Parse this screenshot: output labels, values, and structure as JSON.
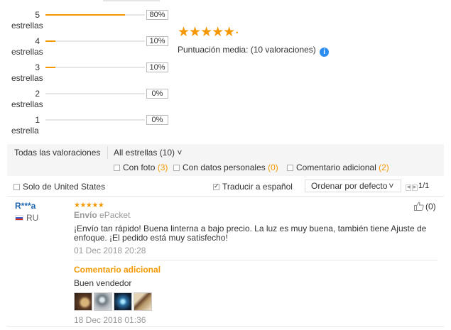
{
  "distribution": [
    {
      "num": "5",
      "word": "estrellas",
      "pct_label": "80%",
      "fill": 0.8
    },
    {
      "num": "4",
      "word": "estrellas",
      "pct_label": "10%",
      "fill": 0.1
    },
    {
      "num": "3",
      "word": "estrellas",
      "pct_label": "10%",
      "fill": 0.1
    },
    {
      "num": "2",
      "word": "estrellas",
      "pct_label": "0%",
      "fill": 0.0
    },
    {
      "num": "1",
      "word": "estrella",
      "pct_label": "0%",
      "fill": 0.0
    }
  ],
  "average": {
    "stars": "★★★★★",
    "label": "Puntuación media:",
    "count": "(10 valoraciones)",
    "info_icon": "info-icon"
  },
  "filters": {
    "all_label": "Todas las valoraciones",
    "select_value": "All estrellas (10)",
    "chevron": "˅",
    "photo_label": "Con foto",
    "photo_count": "(3)",
    "personal_label": "Con datos personales",
    "personal_count": "(0)",
    "additional_label": "Comentario adicional",
    "additional_count": "(2)"
  },
  "options": {
    "us_only": "Solo de United States",
    "translate": "Traducir a español",
    "sort_value": "Ordenar por defecto",
    "sort_chevron": "˅",
    "pager": "1/1"
  },
  "review": {
    "user": "R***a",
    "country": "RU",
    "stars": "★★★★★",
    "ship_label": "Envío",
    "ship_method": "ePacket",
    "text": "¡Envío tan rápido! Buena linterna a bajo precio. La luz es muy buena, también tiene Ajuste de enfoque. ¡El pedido está muy satisfecho!",
    "date": "01 Dec 2018 20:28",
    "additional_label": "Comentario adicional",
    "additional_text": "Buen vendedor",
    "additional_date": "18 Dec 2018 01:36",
    "likes": "(0)"
  },
  "colors": {
    "accent": "#f39800",
    "link": "#2066b2",
    "info": "#2d8cf0"
  }
}
